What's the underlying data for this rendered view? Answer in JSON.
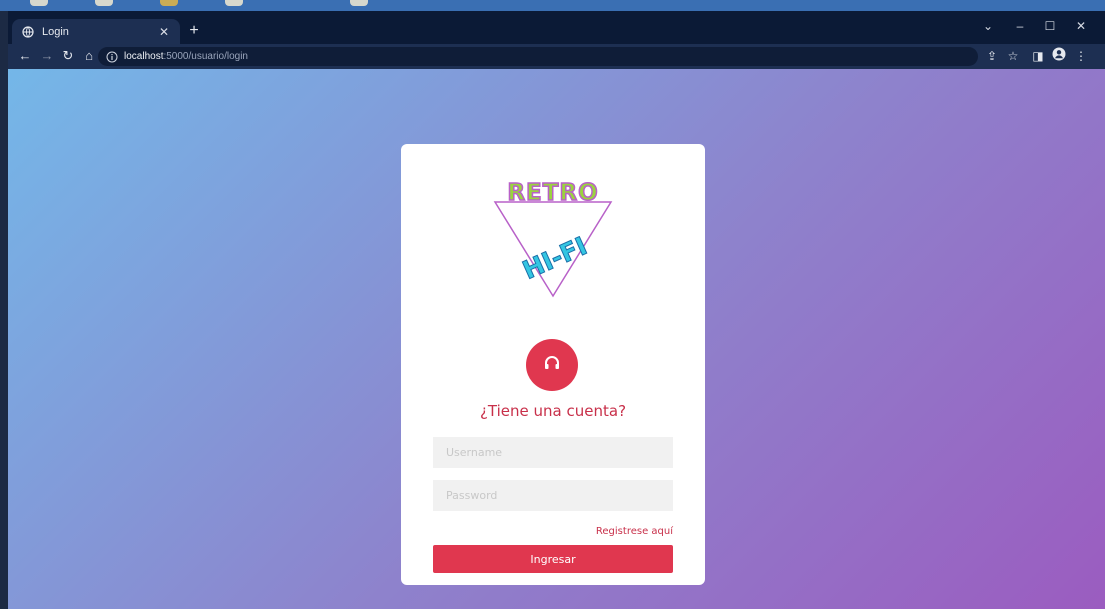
{
  "browser": {
    "tab_title": "Login",
    "new_tab_glyph": "+",
    "url_host": "localhost",
    "url_rest": ":5000/usuario/login"
  },
  "logo": {
    "line1": "RETRO",
    "line2": "HI-FI"
  },
  "login": {
    "heading": "¿Tiene una cuenta?",
    "username_placeholder": "Username",
    "password_placeholder": "Password",
    "register_link": "Registrese aquí",
    "submit_label": "Ingresar"
  },
  "colors": {
    "accent": "#e0374f",
    "heading": "#c8304a",
    "gradient_start": "#74b7e8",
    "gradient_end": "#9b5cc0"
  },
  "icons": {
    "avatar_icon": "headphones-icon"
  }
}
